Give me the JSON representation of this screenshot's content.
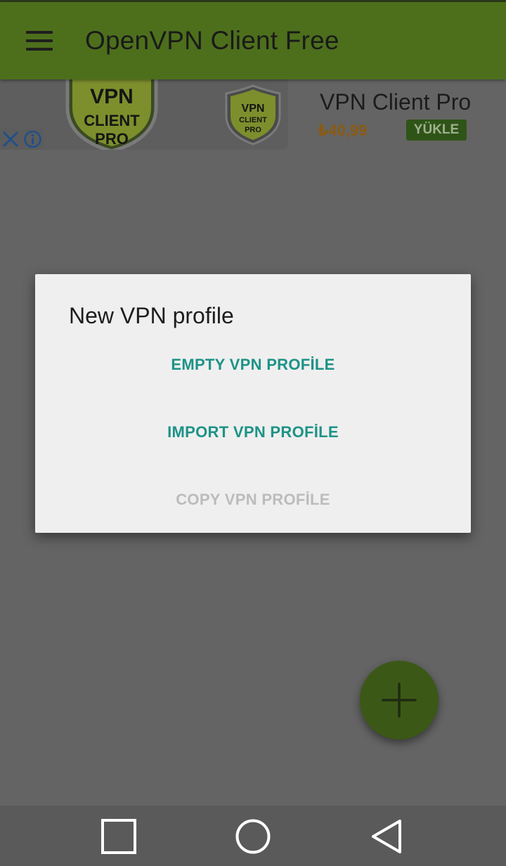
{
  "app": {
    "title": "OpenVPN Client Free"
  },
  "toolbar": {
    "menu_icon": "hamburger-menu-icon"
  },
  "ad": {
    "app_title": "VPN Client Pro",
    "price": "₺40,99",
    "install_label": "YÜKLE",
    "logo_large_lines": [
      "VPN",
      "CLIENT",
      "PRO"
    ],
    "logo_small_lines": [
      "VPN",
      "CLIENT",
      "PRO"
    ],
    "close_icon": "close-icon",
    "info_icon": "info-icon"
  },
  "dialog": {
    "title": "New VPN profile",
    "options": [
      {
        "label": "EMPTY VPN PROFİLE",
        "enabled": true
      },
      {
        "label": "IMPORT VPN PROFİLE",
        "enabled": true
      },
      {
        "label": "COPY VPN PROFİLE",
        "enabled": false
      }
    ]
  },
  "fab": {
    "icon": "add-icon"
  },
  "navbar": {
    "recents_icon": "recents-square-icon",
    "home_icon": "home-circle-icon",
    "back_icon": "back-triangle-icon"
  },
  "colors": {
    "toolbar": "#4d6f1c",
    "accent_teal": "#1d9387",
    "fab": "#3c5816",
    "scrim_background": "#646464",
    "dialog_background": "#efefef",
    "price": "#8a5a12",
    "install_button": "#2f5417"
  }
}
